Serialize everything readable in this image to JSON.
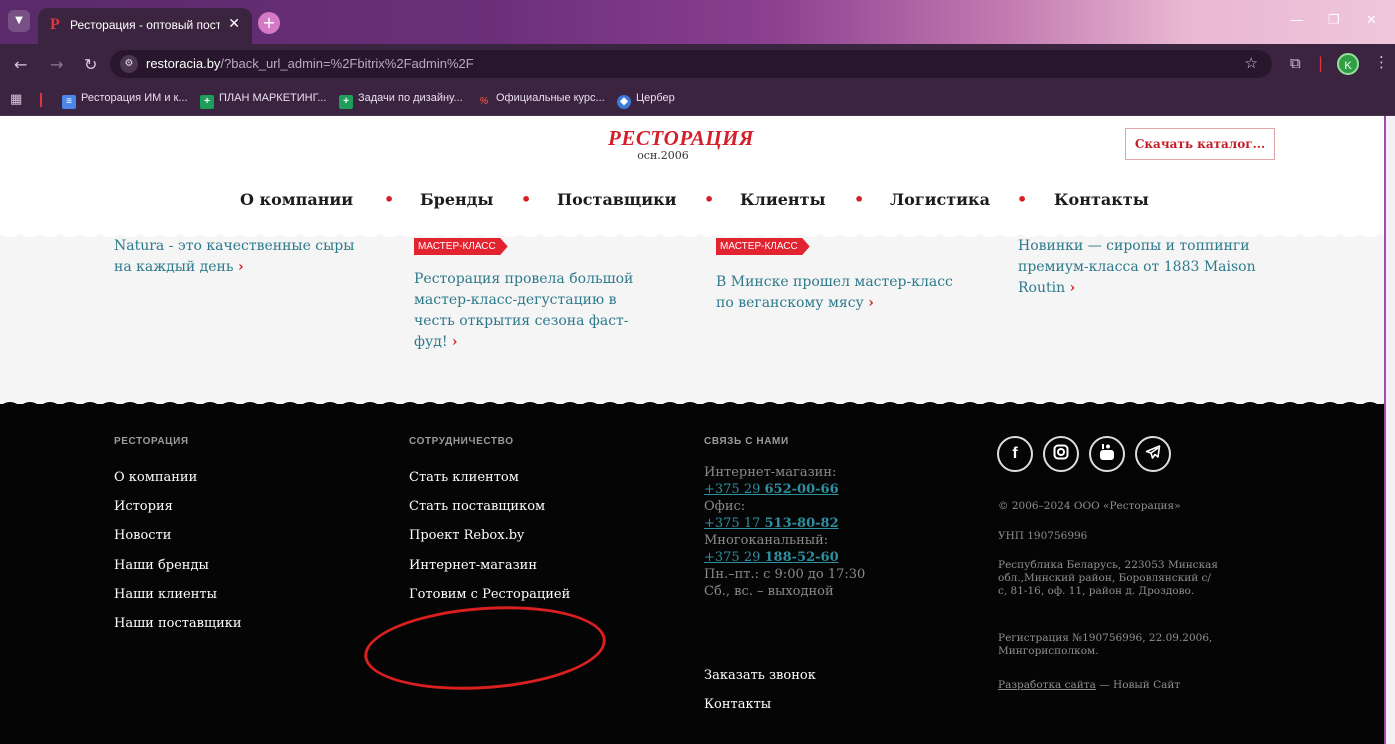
{
  "browser": {
    "tab_title": "Ресторация - оптовый поставщ",
    "tab_favicon": "Р",
    "new_tab_symbol": "+",
    "url_domain": "restoracia.by",
    "url_rest": "/?back_url_admin=%2Fbitrix%2Fadmin%2F",
    "profile_initial": "K",
    "bookmarks": [
      {
        "label": "Ресторация ИМ и к...",
        "icon": "docs-icon",
        "color": "#4a86e8"
      },
      {
        "label": "ПЛАН МАРКЕТИНГ...",
        "icon": "sheets-icon",
        "color": "#1e9e5a"
      },
      {
        "label": "Задачи по дизайну...",
        "icon": "sheets-icon",
        "color": "#1e9e5a"
      },
      {
        "label": "Официальные курс...",
        "icon": "course-icon",
        "color": "#d9463a"
      },
      {
        "label": "Цербер",
        "icon": "cerber-icon",
        "color": "#3c7ad8"
      }
    ]
  },
  "header": {
    "logo_word": "РЕСТОРАЦИЯ",
    "logo_year": "осн.2006",
    "catalog_button": "Скачать каталог...",
    "nav": [
      "О компании",
      "Бренды",
      "Поставщики",
      "Клиенты",
      "Логистика",
      "Контакты"
    ]
  },
  "news": [
    {
      "badge": "",
      "text": "Natura - это качественные сыры на каждый день",
      "arrow": "›"
    },
    {
      "badge": "МАСТЕР-КЛАСС",
      "text": "Ресторация провела большой мастер-класс-дегустацию в честь открытия сезона фаст-фуд!",
      "arrow": "›"
    },
    {
      "badge": "МАСТЕР-КЛАСС",
      "text": "В Минске прошел мастер-класс по веганскому мясу",
      "arrow": "›"
    },
    {
      "badge": "",
      "text": "Новинки — сиропы и топпинги премиум-класса от 1883 Maison Routin",
      "arrow": "›"
    }
  ],
  "footer": {
    "col1": {
      "heading": "РЕСТОРАЦИЯ",
      "links": [
        "О компании",
        "История",
        "Новости",
        "Наши бренды",
        "Наши клиенты",
        "Наши поставщики"
      ]
    },
    "col2": {
      "heading": "СОТРУДНИЧЕСТВО",
      "links": [
        "Стать клиентом",
        "Стать поставщиком",
        "Проект Rebox.by",
        "Интернет-магазин",
        "Готовим с Ресторацией"
      ]
    },
    "col3": {
      "heading": "СВЯЗЬ С НАМИ",
      "shop_label": "Интернет-магазин:",
      "shop_phone_prefix": "+375 29 ",
      "shop_phone_main": "652-00-66",
      "office_label": "Офис:",
      "office_phone_prefix": "+375 17 ",
      "office_phone_main": "513-80-82",
      "multi_label": "Многоканальный:",
      "multi_phone_prefix": "+375 29 ",
      "multi_phone_main": "188-52-60",
      "hours": "Пн.–пт.: с 9:00 до 17:30",
      "weekend": "Сб., вс. – выходной",
      "callback": "Заказать звонок",
      "contacts": "Контакты"
    },
    "col4": {
      "social": [
        "facebook-icon",
        "instagram-icon",
        "youtube-icon",
        "telegram-icon"
      ],
      "copyright": "© 2006–2024 ООО «Ресторация»",
      "unp": "УНП 190756996",
      "address": "Республика Беларусь, 223053 Минская обл.,Минский район, Боровлянский с/с, 81-16, оф. 11, район д. Дроздово.",
      "registration": "Регистрация №190756996, 22.09.2006, Мингорисполком.",
      "dev_link": "Разработка сайта",
      "dev_rest": " — Новый Сайт"
    }
  },
  "colors": {
    "brand_red": "#d41f2a",
    "link_teal": "#2d7a8c",
    "footer_bg": "#050505",
    "annotation_red": "#d91f1f"
  }
}
